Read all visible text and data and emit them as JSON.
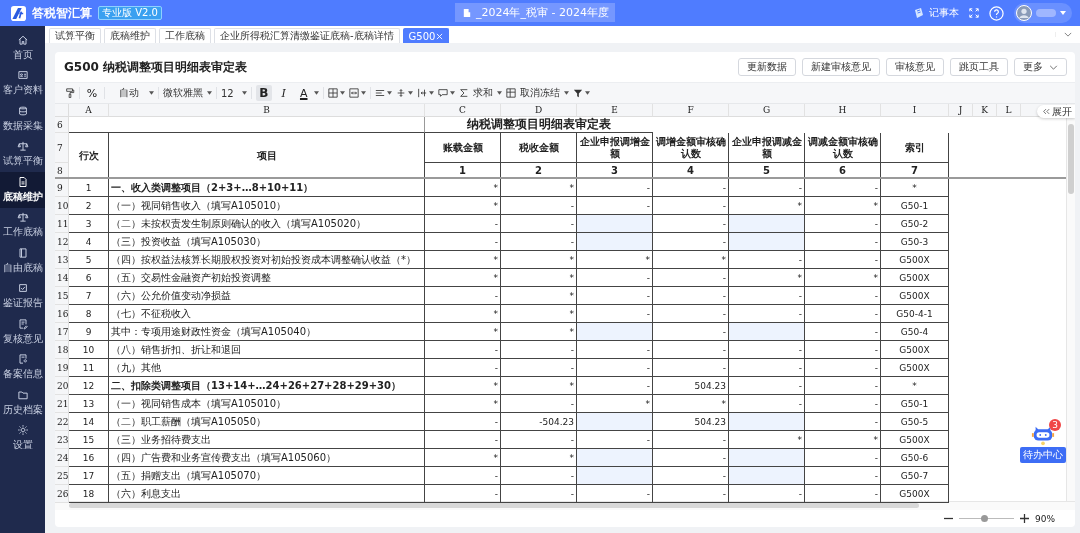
{
  "app": {
    "name": "答税智汇算",
    "edition": "专业版 V2.0",
    "project": "_2024年_税审 - 2024年度",
    "notepad": "记事本"
  },
  "sidebar": [
    {
      "label": "首页",
      "selected": false
    },
    {
      "label": "客户资料",
      "selected": false
    },
    {
      "label": "数据采集",
      "selected": false
    },
    {
      "label": "试算平衡",
      "selected": false
    },
    {
      "label": "底稿维护",
      "selected": true
    },
    {
      "label": "工作底稿",
      "selected": false
    },
    {
      "label": "自由底稿",
      "selected": false
    },
    {
      "label": "鉴证报告",
      "selected": false
    },
    {
      "label": "复核意见",
      "selected": false
    },
    {
      "label": "备案信息",
      "selected": false
    },
    {
      "label": "历史档案",
      "selected": false
    },
    {
      "label": "设置",
      "selected": false
    }
  ],
  "tabs": [
    {
      "label": "试算平衡",
      "selected": false,
      "closable": false
    },
    {
      "label": "底稿维护",
      "selected": false,
      "closable": false
    },
    {
      "label": "工作底稿",
      "selected": false,
      "closable": false
    },
    {
      "label": "企业所得税汇算清缴鉴证底稿-底稿详情",
      "selected": false,
      "closable": false
    },
    {
      "label": "G500",
      "selected": true,
      "closable": true
    }
  ],
  "sheet_title": "G500 纳税调整项目明细表审定表",
  "actions": [
    "更新数据",
    "新建审核意见",
    "审核意见",
    "跳页工具",
    "更多"
  ],
  "toolbar": {
    "percent": "%",
    "number_format": "自动",
    "font": "微软雅黑",
    "font_size": "12",
    "bold": {
      "label": "B",
      "on": true
    },
    "italic": "I",
    "font_color": "A",
    "sum": "求和",
    "freeze": "取消冻结"
  },
  "sheet": {
    "columns": [
      "A",
      "B",
      "C",
      "D",
      "E",
      "F",
      "G",
      "H",
      "I",
      "J",
      "K",
      "L"
    ],
    "row_numbers": [
      "6",
      "7",
      "8",
      "9",
      "10",
      "11",
      "12",
      "13",
      "14",
      "15",
      "16",
      "17",
      "18",
      "19",
      "20",
      "21",
      "22",
      "23",
      "24",
      "25",
      "26"
    ],
    "title": "纳税调整项目明细表审定表",
    "headers": [
      "行次",
      "项目"
    ],
    "value_headers": [
      {
        "label": "账载金额",
        "number": "1"
      },
      {
        "label": "税收金额",
        "number": "2"
      },
      {
        "label": "企业申报调增金额",
        "number": "3"
      },
      {
        "label": "调增金额审核确认数",
        "number": "4"
      },
      {
        "label": "企业申报调减金额",
        "number": "5"
      },
      {
        "label": "调减金额审核确认数",
        "number": "6"
      },
      {
        "label": "索引",
        "number": "7"
      }
    ],
    "rows": [
      {
        "no": "1",
        "item": "一、收入类调整项目（2+3+…8+10+11）",
        "bold": true,
        "cells": [
          "*",
          "*",
          "-",
          "-",
          "-",
          "-"
        ],
        "shaded": [
          false,
          false,
          false,
          false,
          false,
          false
        ],
        "index": "*"
      },
      {
        "no": "2",
        "item": "（一）视同销售收入（填写A105010）",
        "bold": false,
        "cells": [
          "*",
          "-",
          "-",
          "-",
          "*",
          "*"
        ],
        "shaded": [
          false,
          false,
          false,
          false,
          false,
          false
        ],
        "index": "G50-1"
      },
      {
        "no": "3",
        "item": "（二）未按权责发生制原则确认的收入（填写A105020）",
        "bold": false,
        "cells": [
          "-",
          "-",
          null,
          "-",
          null,
          "-"
        ],
        "shaded": [
          false,
          false,
          true,
          false,
          true,
          false
        ],
        "index": "G50-2"
      },
      {
        "no": "4",
        "item": "（三）投资收益（填写A105030）",
        "bold": false,
        "cells": [
          "-",
          "-",
          null,
          "-",
          null,
          "-"
        ],
        "shaded": [
          false,
          false,
          true,
          false,
          true,
          false
        ],
        "index": "G50-3"
      },
      {
        "no": "5",
        "item": "（四）按权益法核算长期股权投资对初始投资成本调整确认收益（*）",
        "bold": false,
        "cells": [
          "*",
          "*",
          "*",
          "*",
          "-",
          "-"
        ],
        "shaded": [
          false,
          false,
          false,
          false,
          false,
          false
        ],
        "index": "G500X"
      },
      {
        "no": "6",
        "item": "（五）交易性金融资产初始投资调整",
        "bold": false,
        "cells": [
          "*",
          "*",
          "-",
          "-",
          "*",
          "*"
        ],
        "shaded": [
          false,
          false,
          false,
          false,
          false,
          false
        ],
        "index": "G500X"
      },
      {
        "no": "7",
        "item": "（六）公允价值变动净损益",
        "bold": false,
        "cells": [
          "-",
          "*",
          "-",
          "-",
          "-",
          "-"
        ],
        "shaded": [
          false,
          false,
          false,
          false,
          false,
          false
        ],
        "index": "G500X"
      },
      {
        "no": "8",
        "item": "（七）不征税收入",
        "bold": false,
        "cells": [
          "*",
          "*",
          "-",
          "-",
          "-",
          "-"
        ],
        "shaded": [
          false,
          false,
          false,
          false,
          false,
          false
        ],
        "index": "G50-4-1"
      },
      {
        "no": "9",
        "item": "其中：专项用途财政性资金（填写A105040）",
        "bold": false,
        "cells": [
          "*",
          "*",
          null,
          "-",
          null,
          "-"
        ],
        "shaded": [
          false,
          false,
          true,
          false,
          true,
          false
        ],
        "index": "G50-4"
      },
      {
        "no": "10",
        "item": "（八）销售折扣、折让和退回",
        "bold": false,
        "cells": [
          "-",
          "-",
          "-",
          "-",
          "-",
          "-"
        ],
        "shaded": [
          false,
          false,
          false,
          false,
          false,
          false
        ],
        "index": "G500X"
      },
      {
        "no": "11",
        "item": "（九）其他",
        "bold": false,
        "cells": [
          "-",
          "-",
          "-",
          "-",
          "-",
          "-"
        ],
        "shaded": [
          false,
          false,
          false,
          false,
          false,
          false
        ],
        "index": "G500X"
      },
      {
        "no": "12",
        "item": "二、扣除类调整项目（13+14+…24+26+27+28+29+30）",
        "bold": true,
        "cells": [
          "*",
          "*",
          "-",
          "504.23",
          "-",
          "-"
        ],
        "shaded": [
          false,
          false,
          false,
          false,
          false,
          false
        ],
        "index": "*"
      },
      {
        "no": "13",
        "item": "（一）视同销售成本（填写A105010）",
        "bold": false,
        "cells": [
          "*",
          "-",
          "*",
          "*",
          "-",
          "-"
        ],
        "shaded": [
          false,
          false,
          false,
          false,
          false,
          false
        ],
        "index": "G50-1"
      },
      {
        "no": "14",
        "item": "（二）职工薪酬（填写A105050）",
        "bold": false,
        "cells": [
          "-",
          "-504.23",
          null,
          "504.23",
          null,
          "-"
        ],
        "shaded": [
          false,
          false,
          true,
          false,
          true,
          false
        ],
        "index": "G50-5"
      },
      {
        "no": "15",
        "item": "（三）业务招待费支出",
        "bold": false,
        "cells": [
          "-",
          "-",
          "-",
          "-",
          "*",
          "*"
        ],
        "shaded": [
          false,
          false,
          false,
          false,
          false,
          false
        ],
        "index": "G500X"
      },
      {
        "no": "16",
        "item": "（四）广告费和业务宣传费支出（填写A105060）",
        "bold": false,
        "cells": [
          "*",
          "*",
          null,
          "-",
          null,
          "-"
        ],
        "shaded": [
          false,
          false,
          true,
          false,
          true,
          false
        ],
        "index": "G50-6"
      },
      {
        "no": "17",
        "item": "（五）捐赠支出（填写A105070）",
        "bold": false,
        "cells": [
          "-",
          "-",
          null,
          "-",
          null,
          "-"
        ],
        "shaded": [
          false,
          false,
          true,
          false,
          true,
          false
        ],
        "index": "G50-7"
      },
      {
        "no": "18",
        "item": "（六）利息支出",
        "bold": false,
        "cells": [
          "-",
          "-",
          "-",
          "-",
          "-",
          "-"
        ],
        "shaded": [
          false,
          false,
          false,
          false,
          false,
          false
        ],
        "index": "G500X"
      }
    ]
  },
  "expand_tab": "展开",
  "todo": {
    "label": "待办中心",
    "count": "3"
  },
  "zoom": {
    "level": 0.45,
    "value": "90%"
  }
}
